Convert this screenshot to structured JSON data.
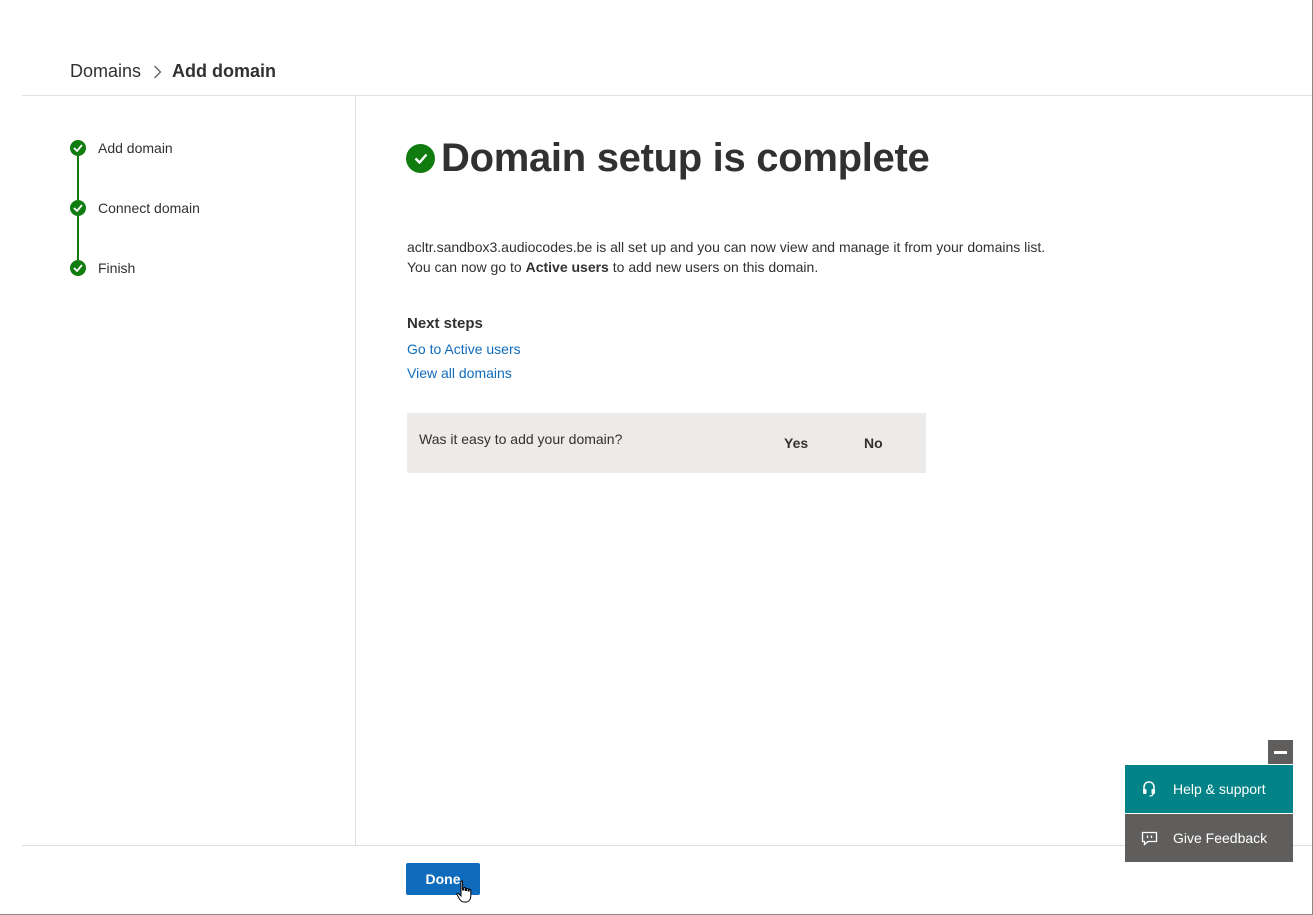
{
  "breadcrumb": {
    "root": "Domains",
    "current": "Add domain"
  },
  "steps": [
    {
      "label": "Add domain",
      "status": "complete"
    },
    {
      "label": "Connect domain",
      "status": "complete"
    },
    {
      "label": "Finish",
      "status": "complete"
    }
  ],
  "main": {
    "title": "Domain setup is complete",
    "desc_line1": "acltr.sandbox3.audiocodes.be is all set up and you can now view and manage it from your domains list.",
    "desc_line2_pre": "You can now go to ",
    "desc_line2_bold": "Active users",
    "desc_line2_post": " to add new users on this domain.",
    "next_steps_title": "Next steps",
    "links": {
      "active_users": "Go to Active users",
      "all_domains": "View all domains"
    }
  },
  "feedback": {
    "question": "Was it easy to add your domain?",
    "yes": "Yes",
    "no": "No"
  },
  "footer": {
    "done": "Done"
  },
  "floating": {
    "help": "Help & support",
    "give_feedback": "Give Feedback"
  },
  "colors": {
    "success": "#107c10",
    "link": "#0f6cbd",
    "primary": "#0f6cbd",
    "help_bg": "#038387",
    "feedback_bg": "#605e5c"
  },
  "icons": {
    "step": "check-circle-icon",
    "breadcrumb_separator": "chevron-right-icon",
    "help": "headset-icon",
    "give_feedback": "chat-feedback-icon",
    "minimize": "minimize-icon"
  }
}
